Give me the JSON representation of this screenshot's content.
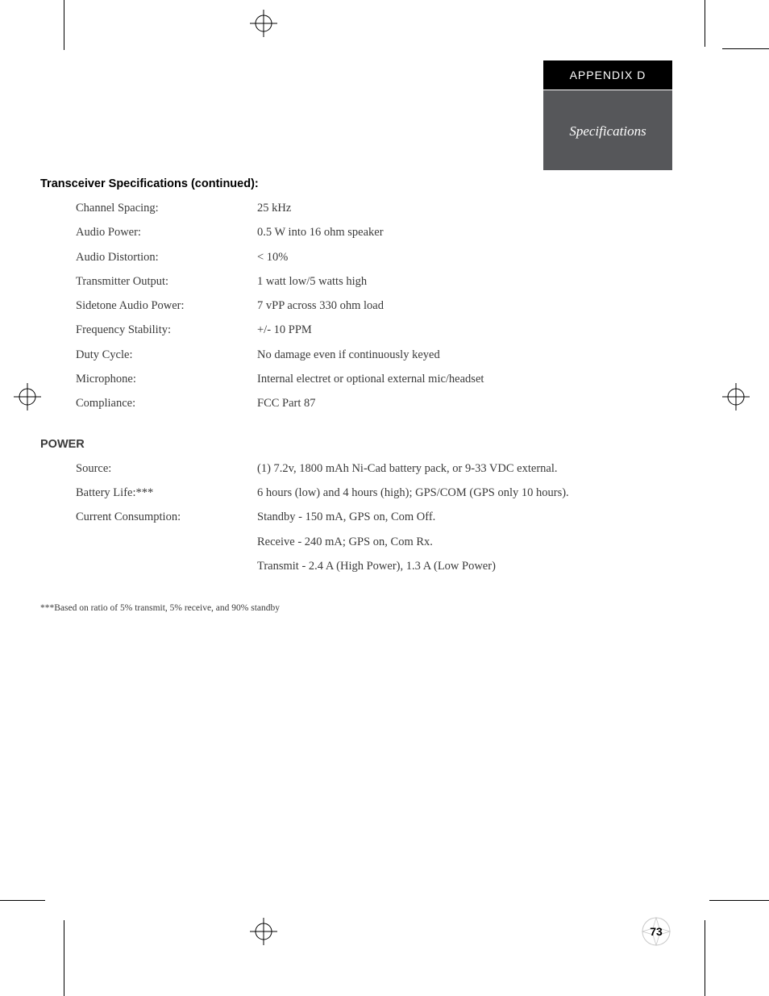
{
  "header": {
    "appendix": "APPENDIX D",
    "title": "Specifications"
  },
  "section1": {
    "title": "Transceiver Specifications (continued):",
    "rows": [
      {
        "label": "Channel Spacing:",
        "value": "25 kHz"
      },
      {
        "label": "Audio Power:",
        "value": "0.5 W into 16 ohm speaker"
      },
      {
        "label": "Audio Distortion:",
        "value": "< 10%"
      },
      {
        "label": "Transmitter Output:",
        "value": "1 watt low/5 watts high"
      },
      {
        "label": "Sidetone Audio Power:",
        "value": "7 vPP across 330 ohm load"
      },
      {
        "label": "Frequency Stability:",
        "value": " +/- 10 PPM"
      },
      {
        "label": "Duty Cycle:",
        "value": "No damage even if continuously keyed"
      },
      {
        "label": "Microphone:",
        "value": "Internal electret or optional external mic/headset"
      },
      {
        "label": "Compliance:",
        "value": "FCC Part 87"
      }
    ]
  },
  "section2": {
    "title": "POWER",
    "rows": [
      {
        "label": "Source:",
        "value": "(1) 7.2v, 1800 mAh Ni-Cad battery pack, or 9-33 VDC external."
      },
      {
        "label": "Battery Life:***",
        "value": "6 hours (low) and 4 hours (high); GPS/COM (GPS only 10 hours)."
      },
      {
        "label": "Current Consumption:",
        "value": "Standby - 150 mA, GPS on, Com Off."
      },
      {
        "label": "",
        "value": "Receive - 240 mA; GPS on, Com Rx."
      },
      {
        "label": "",
        "value": "Transmit - 2.4 A (High Power), 1.3 A (Low Power)"
      }
    ]
  },
  "footnote": "***Based on ratio of 5% transmit, 5% receive, and 90% standby",
  "pageNumber": "73"
}
